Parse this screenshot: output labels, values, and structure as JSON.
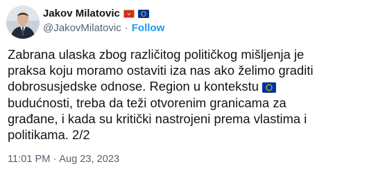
{
  "author": {
    "display_name": "Jakov Milatovic",
    "handle": "@JakovMilatovic",
    "follow_label": "Follow",
    "separator": "·",
    "avatar_icon": "profile-photo-avatar",
    "flag_icons": [
      "montenegro-flag-icon",
      "eu-flag-icon"
    ]
  },
  "tweet": {
    "text_part1": "Zabrana ulaska zbog različitog političkog mišljenja je\npraksa koju moramo ostaviti iza nas ako želimo graditi\ndobrosusjedske odnose. Region u kontekstu ",
    "inline_flag_icon": "eu-flag-icon",
    "text_part2": "\nbudućnosti, treba da teži otvorenim granicama za\ngrađane, i kada su kritički nastrojeni prema vlastima i\npolitikama. 2/2"
  },
  "meta": {
    "time": "11:01 PM",
    "separator": "·",
    "date": "Aug 23, 2023"
  },
  "colors": {
    "text": "#0f1419",
    "secondary": "#536471",
    "accent": "#1d9bf0",
    "eu_blue": "#003399",
    "eu_star": "#ffcc00",
    "montenegro_red": "#d3292e",
    "montenegro_gold": "#d4af37"
  }
}
